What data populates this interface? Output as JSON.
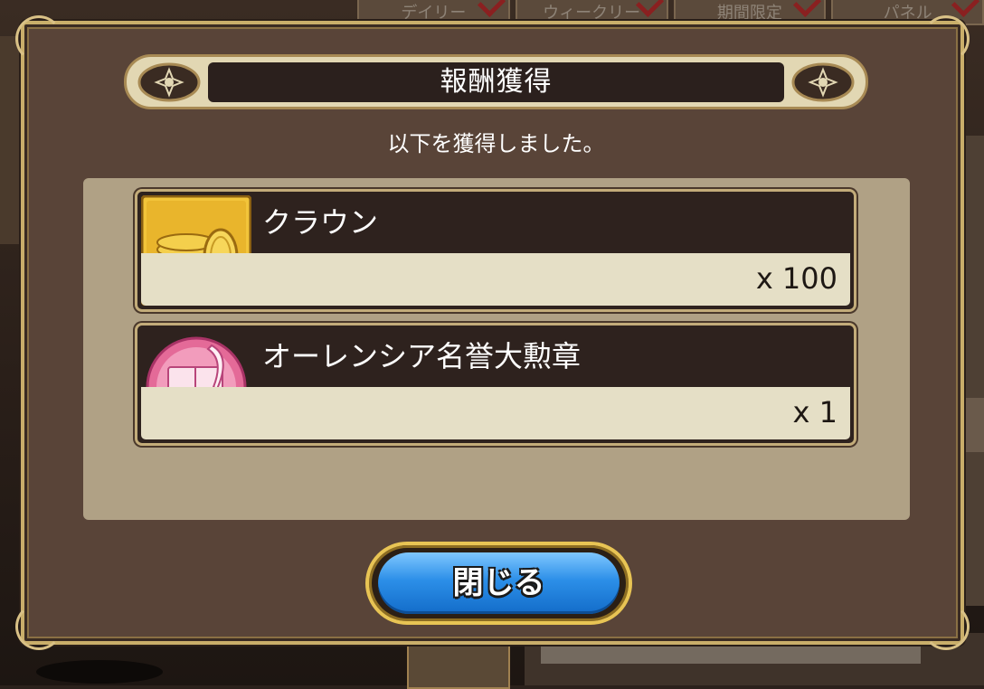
{
  "background": {
    "tabs": [
      "デイリー",
      "ウィークリー",
      "期間限定",
      "パネル"
    ]
  },
  "dialog": {
    "title": "報酬獲得",
    "subtitle": "以下を獲得しました。",
    "rewards": [
      {
        "name": "クラウン",
        "quantity": "x 100",
        "icon": "gold-coins-icon"
      },
      {
        "name": "オーレンシア名誉大勲章",
        "quantity": "x 1",
        "icon": "honor-medal-icon"
      }
    ],
    "close_label": "閉じる"
  },
  "colors": {
    "frame_gold": "#c9ae6a",
    "dialog_bg": "#594438",
    "button_blue": "#2c8fe8"
  }
}
